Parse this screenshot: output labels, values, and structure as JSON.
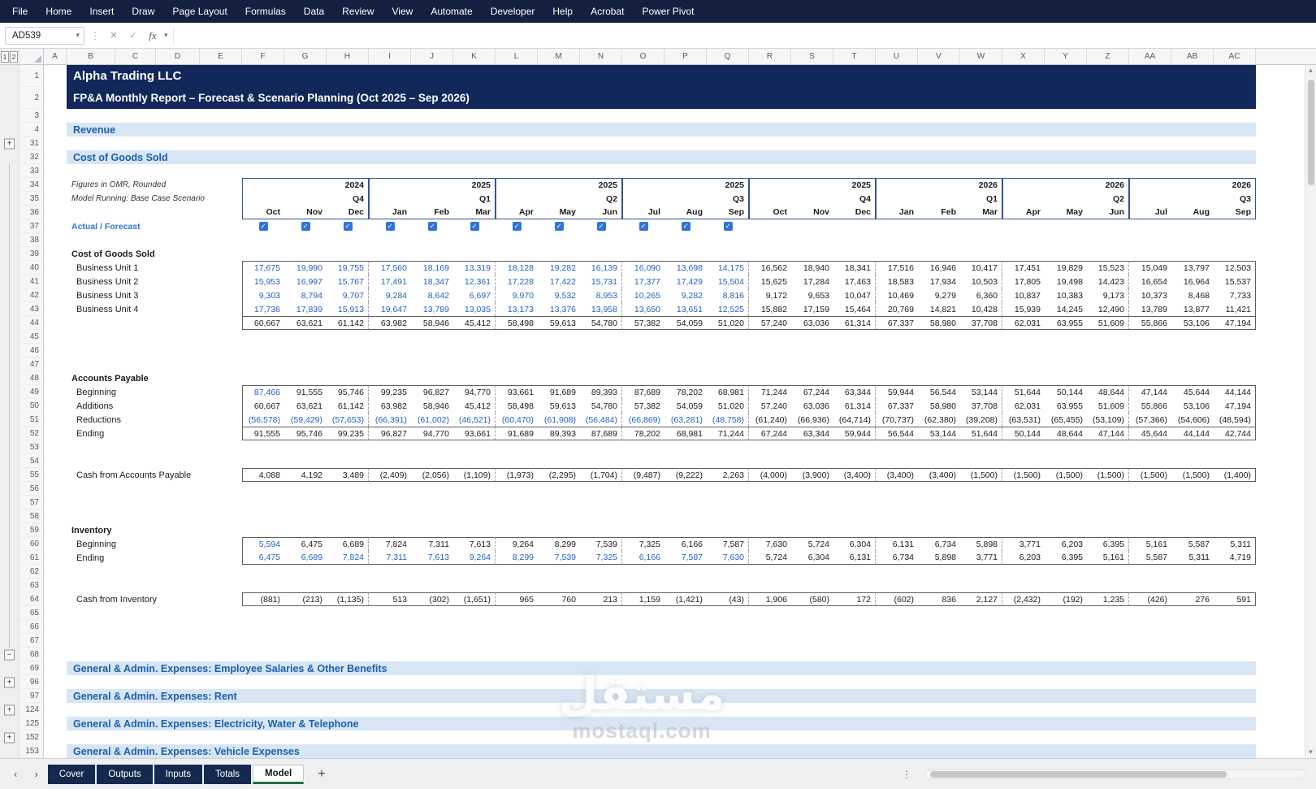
{
  "menu_bar": {
    "items": [
      "File",
      "Home",
      "Insert",
      "Draw",
      "Page Layout",
      "Formulas",
      "Data",
      "Review",
      "View",
      "Automate",
      "Developer",
      "Help",
      "Acrobat",
      "Power Pivot"
    ]
  },
  "formula_bar": {
    "name_box": "AD539",
    "fx_label": "fx",
    "formula_value": ""
  },
  "outline_levels": [
    "1",
    "2"
  ],
  "column_headers": [
    "A",
    "B",
    "C",
    "D",
    "E",
    "F",
    "G",
    "H",
    "I",
    "J",
    "K",
    "L",
    "M",
    "N",
    "O",
    "P",
    "Q",
    "R",
    "S",
    "T",
    "U",
    "V",
    "W",
    "X",
    "Y",
    "Z",
    "AA",
    "AB",
    "AC"
  ],
  "header": {
    "years": [
      "2024",
      "2025",
      "2025",
      "2025",
      "2025",
      "2026",
      "2026",
      "2026"
    ],
    "quarters": [
      "Q4",
      "Q1",
      "Q2",
      "Q3",
      "Q4",
      "Q1",
      "Q2",
      "Q3"
    ],
    "months": [
      "Oct",
      "Nov",
      "Dec",
      "Jan",
      "Feb",
      "Mar",
      "Apr",
      "May",
      "Jun",
      "Jul",
      "Aug",
      "Sep",
      "Oct",
      "Nov",
      "Dec",
      "Jan",
      "Feb",
      "Mar",
      "Apr",
      "May",
      "Jun",
      "Jul",
      "Aug",
      "Sep"
    ],
    "checkboxes": [
      true,
      true,
      true,
      true,
      true,
      true,
      true,
      true,
      true,
      true,
      true,
      true,
      false,
      false,
      false,
      false,
      false,
      false,
      false,
      false,
      false,
      false,
      false,
      false
    ]
  },
  "sheet": {
    "rows": [
      {
        "n": 1,
        "kind": "title1",
        "text": "Alpha Trading LLC"
      },
      {
        "n": 2,
        "kind": "title2",
        "text": "FP&A Monthly Report – Forecast & Scenario Planning (Oct 2025 – Sep 2026)"
      },
      {
        "n": 3,
        "kind": "blank"
      },
      {
        "n": 4,
        "kind": "section",
        "text": "Revenue"
      },
      {
        "n": 31,
        "kind": "blank",
        "outline": "plus"
      },
      {
        "n": 32,
        "kind": "section",
        "text": "Cost of Goods Sold"
      },
      {
        "n": 33,
        "kind": "blank",
        "outline": "line"
      },
      {
        "n": 34,
        "kind": "year",
        "label": "Figures in OMR, Rounded",
        "outline": "line"
      },
      {
        "n": 35,
        "kind": "quarter",
        "label": "Model Running: Base Case Scenario",
        "outline": "line"
      },
      {
        "n": 36,
        "kind": "months",
        "outline": "line"
      },
      {
        "n": 37,
        "kind": "checks",
        "label": "Actual / Forecast",
        "outline": "line"
      },
      {
        "n": 38,
        "kind": "blank",
        "outline": "line"
      },
      {
        "n": 39,
        "kind": "glabel",
        "text": "Cost of Goods Sold",
        "outline": "line"
      },
      {
        "n": 40,
        "kind": "data",
        "label": "Business Unit 1",
        "outline": "line",
        "color": "blue12",
        "block": "start",
        "values": [
          "17,675",
          "19,990",
          "19,755",
          "17,560",
          "18,169",
          "13,319",
          "18,128",
          "19,282",
          "16,139",
          "16,090",
          "13,698",
          "14,175",
          "16,562",
          "18,940",
          "18,341",
          "17,516",
          "16,946",
          "10,417",
          "17,451",
          "19,829",
          "15,523",
          "15,049",
          "13,797",
          "12,503"
        ]
      },
      {
        "n": 41,
        "kind": "data",
        "label": "Business Unit 2",
        "outline": "line",
        "color": "blue12",
        "block": "mid",
        "values": [
          "15,953",
          "16,997",
          "15,767",
          "17,491",
          "18,347",
          "12,361",
          "17,228",
          "17,422",
          "15,731",
          "17,377",
          "17,429",
          "15,504",
          "15,625",
          "17,284",
          "17,463",
          "18,583",
          "17,934",
          "10,503",
          "17,805",
          "19,498",
          "14,423",
          "16,654",
          "16,964",
          "15,537"
        ]
      },
      {
        "n": 42,
        "kind": "data",
        "label": "Business Unit 3",
        "outline": "line",
        "color": "blue12",
        "block": "mid",
        "values": [
          "9,303",
          "8,794",
          "9,707",
          "9,284",
          "8,642",
          "6,697",
          "9,970",
          "9,532",
          "8,953",
          "10,265",
          "9,282",
          "8,816",
          "9,172",
          "9,653",
          "10,047",
          "10,469",
          "9,279",
          "6,360",
          "10,837",
          "10,383",
          "9,173",
          "10,373",
          "8,468",
          "7,733"
        ]
      },
      {
        "n": 43,
        "kind": "data",
        "label": "Business Unit 4",
        "outline": "line",
        "color": "blue12",
        "block": "mid",
        "values": [
          "17,736",
          "17,839",
          "15,913",
          "19,647",
          "13,789",
          "13,035",
          "13,173",
          "13,376",
          "13,958",
          "13,650",
          "13,651",
          "12,525",
          "15,882",
          "17,159",
          "15,464",
          "20,769",
          "14,821",
          "10,428",
          "15,939",
          "14,245",
          "12,490",
          "13,789",
          "13,877",
          "11,421"
        ]
      },
      {
        "n": 44,
        "kind": "data",
        "label": "",
        "outline": "line",
        "color": "none",
        "block": "end",
        "total": true,
        "values": [
          "60,667",
          "63,621",
          "61,142",
          "63,982",
          "58,946",
          "45,412",
          "58,498",
          "59,613",
          "54,780",
          "57,382",
          "54,059",
          "51,020",
          "57,240",
          "63,036",
          "61,314",
          "67,337",
          "58,980",
          "37,708",
          "62,031",
          "63,955",
          "51,609",
          "55,866",
          "53,106",
          "47,194"
        ]
      },
      {
        "n": 45,
        "kind": "blank",
        "outline": "line"
      },
      {
        "n": 46,
        "kind": "blank",
        "outline": "line"
      },
      {
        "n": 47,
        "kind": "blank",
        "outline": "line"
      },
      {
        "n": 48,
        "kind": "glabel",
        "text": "Accounts Payable",
        "outline": "line"
      },
      {
        "n": 49,
        "kind": "data",
        "label": "Beginning",
        "outline": "line",
        "color": "first",
        "block": "start",
        "values": [
          "87,466",
          "91,555",
          "95,746",
          "99,235",
          "96,827",
          "94,770",
          "93,661",
          "91,689",
          "89,393",
          "87,689",
          "78,202",
          "68,981",
          "71,244",
          "67,244",
          "63,344",
          "59,944",
          "56,544",
          "53,144",
          "51,644",
          "50,144",
          "48,644",
          "47,144",
          "45,644",
          "44,144"
        ]
      },
      {
        "n": 50,
        "kind": "data",
        "label": "Additions",
        "outline": "line",
        "color": "none",
        "block": "mid",
        "values": [
          "60,667",
          "63,621",
          "61,142",
          "63,982",
          "58,946",
          "45,412",
          "58,498",
          "59,613",
          "54,780",
          "57,382",
          "54,059",
          "51,020",
          "57,240",
          "63,036",
          "61,314",
          "67,337",
          "58,980",
          "37,708",
          "62,031",
          "63,955",
          "51,609",
          "55,866",
          "53,106",
          "47,194"
        ]
      },
      {
        "n": 51,
        "kind": "data",
        "label": "Reductions",
        "outline": "line",
        "color": "blue12",
        "block": "mid",
        "values": [
          "(56,578)",
          "(59,429)",
          "(57,653)",
          "(66,391)",
          "(61,002)",
          "(46,521)",
          "(60,470)",
          "(61,908)",
          "(56,484)",
          "(66,869)",
          "(63,281)",
          "(48,758)",
          "(61,240)",
          "(66,936)",
          "(64,714)",
          "(70,737)",
          "(62,380)",
          "(39,208)",
          "(63,531)",
          "(65,455)",
          "(53,109)",
          "(57,366)",
          "(54,606)",
          "(48,594)"
        ]
      },
      {
        "n": 52,
        "kind": "data",
        "label": "Ending",
        "outline": "line",
        "color": "none",
        "block": "end",
        "total": true,
        "values": [
          "91,555",
          "95,746",
          "99,235",
          "96,827",
          "94,770",
          "93,661",
          "91,689",
          "89,393",
          "87,689",
          "78,202",
          "68,981",
          "71,244",
          "67,244",
          "63,344",
          "59,944",
          "56,544",
          "53,144",
          "51,644",
          "50,144",
          "48,644",
          "47,144",
          "45,644",
          "44,144",
          "42,744"
        ]
      },
      {
        "n": 53,
        "kind": "blank",
        "outline": "line"
      },
      {
        "n": 54,
        "kind": "blank",
        "outline": "line"
      },
      {
        "n": 55,
        "kind": "data",
        "label": "Cash from Accounts Payable",
        "outline": "line",
        "color": "none",
        "block": "single",
        "values": [
          "4,088",
          "4,192",
          "3,489",
          "(2,409)",
          "(2,056)",
          "(1,109)",
          "(1,973)",
          "(2,295)",
          "(1,704)",
          "(9,487)",
          "(9,222)",
          "2,263",
          "(4,000)",
          "(3,900)",
          "(3,400)",
          "(3,400)",
          "(3,400)",
          "(1,500)",
          "(1,500)",
          "(1,500)",
          "(1,500)",
          "(1,500)",
          "(1,500)",
          "(1,400)"
        ]
      },
      {
        "n": 56,
        "kind": "blank",
        "outline": "line"
      },
      {
        "n": 57,
        "kind": "blank",
        "outline": "line"
      },
      {
        "n": 58,
        "kind": "blank",
        "outline": "line"
      },
      {
        "n": 59,
        "kind": "glabel",
        "text": "Inventory",
        "outline": "line"
      },
      {
        "n": 60,
        "kind": "data",
        "label": "Beginning",
        "outline": "line",
        "color": "first",
        "block": "start",
        "values": [
          "5,594",
          "6,475",
          "6,689",
          "7,824",
          "7,311",
          "7,613",
          "9,264",
          "8,299",
          "7,539",
          "7,325",
          "6,166",
          "7,587",
          "7,630",
          "5,724",
          "6,304",
          "6,131",
          "6,734",
          "5,898",
          "3,771",
          "6,203",
          "6,395",
          "5,161",
          "5,587",
          "5,311"
        ]
      },
      {
        "n": 61,
        "kind": "data",
        "label": "Ending",
        "outline": "line",
        "color": "blue12",
        "block": "end",
        "values": [
          "6,475",
          "6,689",
          "7,824",
          "7,311",
          "7,613",
          "9,264",
          "8,299",
          "7,539",
          "7,325",
          "6,166",
          "7,587",
          "7,630",
          "5,724",
          "6,304",
          "6,131",
          "6,734",
          "5,898",
          "3,771",
          "6,203",
          "6,395",
          "5,161",
          "5,587",
          "5,311",
          "4,719"
        ]
      },
      {
        "n": 62,
        "kind": "blank",
        "outline": "line"
      },
      {
        "n": 63,
        "kind": "blank",
        "outline": "line"
      },
      {
        "n": 64,
        "kind": "data",
        "label": "Cash from Inventory",
        "outline": "line",
        "color": "none",
        "block": "single",
        "values": [
          "(881)",
          "(213)",
          "(1,135)",
          "513",
          "(302)",
          "(1,651)",
          "965",
          "760",
          "213",
          "1,159",
          "(1,421)",
          "(43)",
          "1,906",
          "(580)",
          "172",
          "(602)",
          "836",
          "2,127",
          "(2,432)",
          "(192)",
          "1,235",
          "(426)",
          "276",
          "591"
        ]
      },
      {
        "n": 65,
        "kind": "blank",
        "outline": "line"
      },
      {
        "n": 66,
        "kind": "blank",
        "outline": "line"
      },
      {
        "n": 67,
        "kind": "blank",
        "outline": "line"
      },
      {
        "n": 68,
        "kind": "blank",
        "outline": "minus"
      },
      {
        "n": 69,
        "kind": "section",
        "text": "General & Admin. Expenses: Employee Salaries & Other Benefits"
      },
      {
        "n": 96,
        "kind": "blank",
        "outline": "plus"
      },
      {
        "n": 97,
        "kind": "section",
        "text": "General & Admin. Expenses: Rent"
      },
      {
        "n": 124,
        "kind": "blank",
        "outline": "plus"
      },
      {
        "n": 125,
        "kind": "section",
        "text": "General & Admin. Expenses: Electricity, Water & Telephone"
      },
      {
        "n": 152,
        "kind": "blank",
        "outline": "plus"
      },
      {
        "n": 153,
        "kind": "section",
        "text": "General & Admin. Expenses: Vehicle Expenses"
      }
    ]
  },
  "sheet_tabs": {
    "tabs": [
      "Cover",
      "Outputs",
      "Inputs",
      "Totals",
      "Model"
    ],
    "active": "Model"
  },
  "watermark": {
    "line1": "مستقل",
    "line2": "mostaql.com"
  }
}
